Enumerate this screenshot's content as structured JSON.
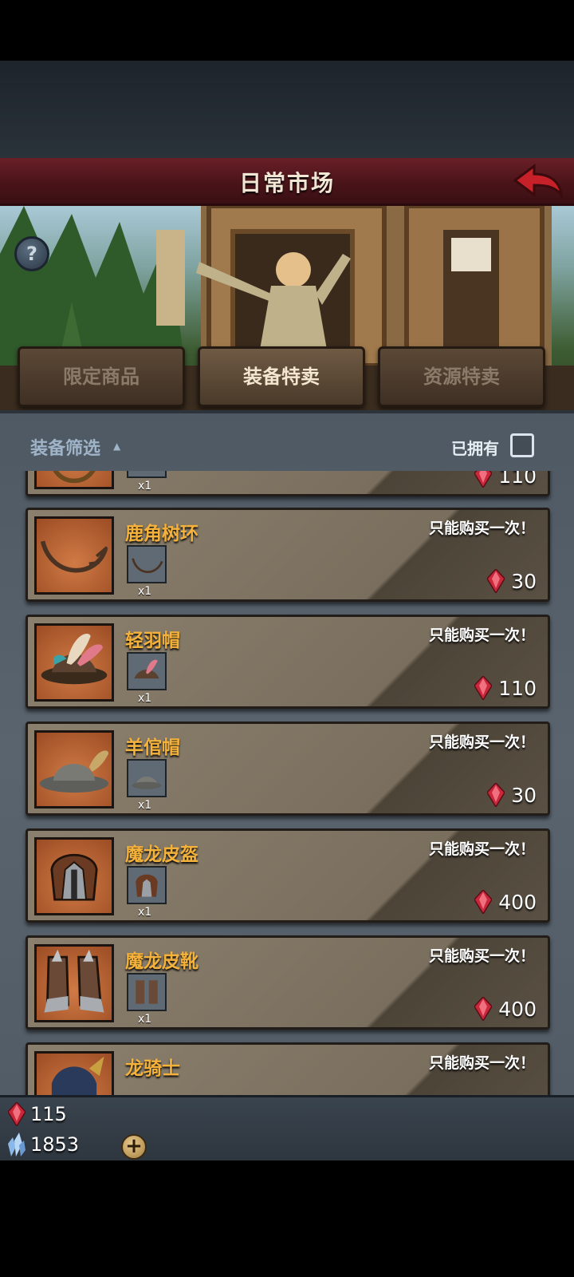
{
  "header": {
    "title": "日常市场"
  },
  "tabs": [
    {
      "label": "限定商品",
      "active": false
    },
    {
      "label": "装备特卖",
      "active": true
    },
    {
      "label": "资源特卖",
      "active": false
    }
  ],
  "filter": {
    "label": "装备筛选",
    "owned_label": "已拥有",
    "owned_checked": false
  },
  "items": [
    {
      "name": "",
      "note": "",
      "qty": "x1",
      "price": "110",
      "icon": "partial-item-icon"
    },
    {
      "name": "鹿角树环",
      "note": "只能购买一次！",
      "qty": "x1",
      "price": "30",
      "icon": "antler-circlet-icon"
    },
    {
      "name": "轻羽帽",
      "note": "只能购买一次！",
      "qty": "x1",
      "price": "110",
      "icon": "feather-hat-icon"
    },
    {
      "name": "羊倌帽",
      "note": "只能购买一次！",
      "qty": "x1",
      "price": "30",
      "icon": "shepherd-hat-icon"
    },
    {
      "name": "魔龙皮盔",
      "note": "只能购买一次！",
      "qty": "x1",
      "price": "400",
      "icon": "dragonhide-helm-icon"
    },
    {
      "name": "魔龙皮靴",
      "note": "只能购买一次！",
      "qty": "x1",
      "price": "400",
      "icon": "dragonhide-boots-icon"
    },
    {
      "name": "龙骑士",
      "note": "只能购买一次！",
      "qty": "",
      "price": "",
      "icon": "dragon-knight-icon"
    }
  ],
  "resources": {
    "ruby": "115",
    "crystal": "1853"
  },
  "colors": {
    "title_bar": "#4a1419",
    "item_name": "#f5b23b",
    "panel": "#56606a",
    "ruby": "#c8283a"
  }
}
